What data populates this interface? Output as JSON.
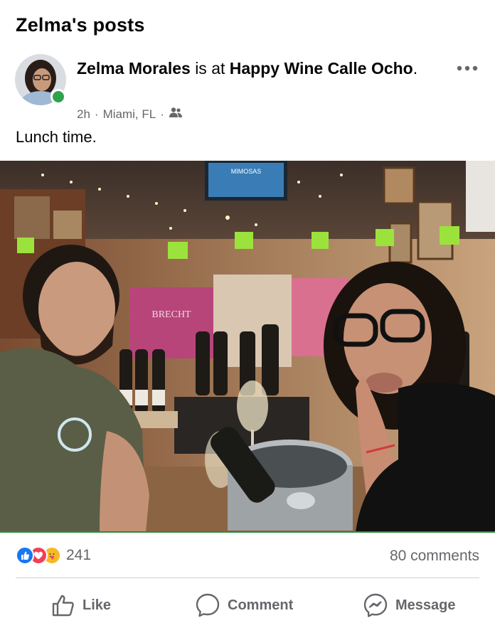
{
  "header": {
    "title": "Zelma's posts"
  },
  "post": {
    "author": "Zelma Morales",
    "connector": "is at",
    "place": "Happy Wine Calle Ocho",
    "time": "2h",
    "location": "Miami, FL",
    "audience_icon": "friends-icon",
    "text": "Lunch time.",
    "photo": {
      "wine_box_text": "BRECHT",
      "tv_text": "MIMOSAS"
    }
  },
  "stats": {
    "reaction_count": "241",
    "comments": "80 comments",
    "reaction_icons": [
      "like-icon",
      "love-icon",
      "care-icon"
    ]
  },
  "actions": {
    "like": "Like",
    "comment": "Comment",
    "message": "Message"
  },
  "colors": {
    "online": "#31a24c",
    "like_blue": "#1877f2",
    "love_red": "#f33e58",
    "muted_text": "#65676b"
  }
}
